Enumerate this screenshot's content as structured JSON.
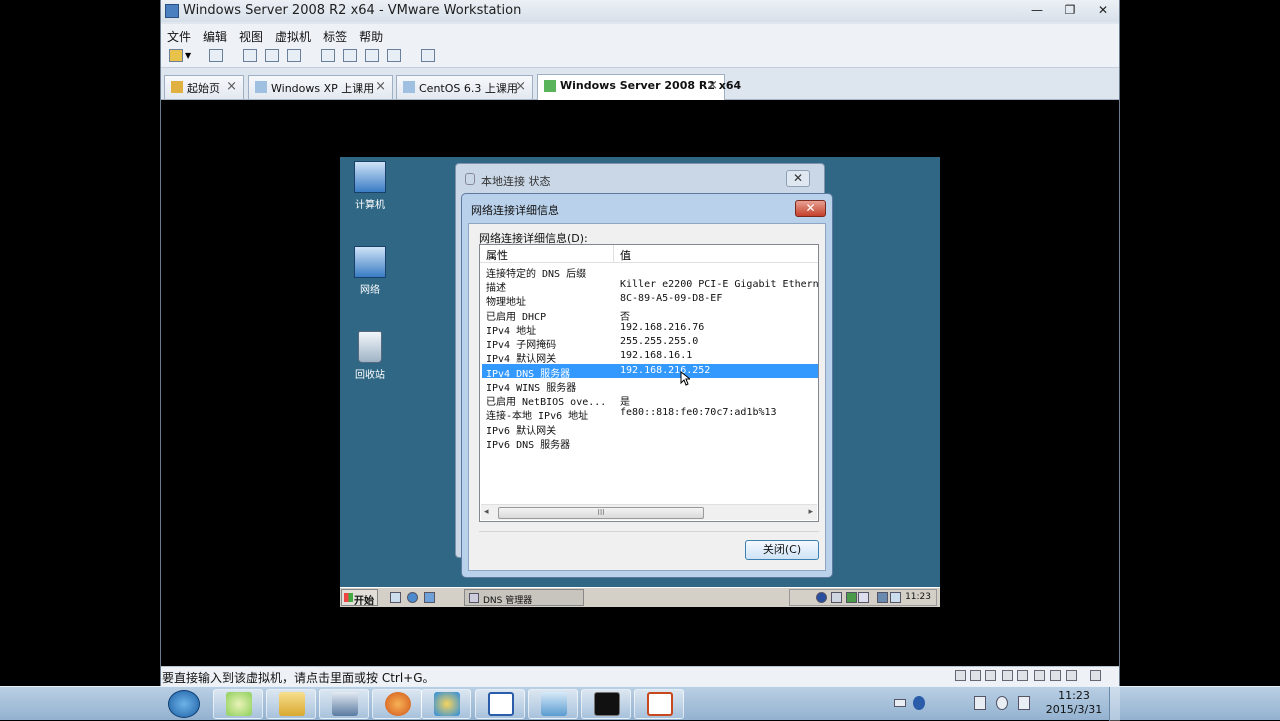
{
  "host_window": {
    "title": "Windows Server 2008 R2 x64 - VMware Workstation",
    "minimize": "—",
    "restore": "❐",
    "close": "✕",
    "menu": [
      "文件",
      "编辑",
      "视图",
      "虚拟机",
      "标签",
      "帮助"
    ],
    "tabs": [
      {
        "label": "起始页",
        "close": "×"
      },
      {
        "label": "Windows XP 上课用",
        "close": "×"
      },
      {
        "label": "CentOS 6.3 上课用",
        "close": "×"
      },
      {
        "label": "Windows Server 2008 R2 x64",
        "close": "×"
      }
    ],
    "status_text": "要直接输入到该虚拟机，请点击里面或按 Ctrl+G。"
  },
  "guest": {
    "desktop_icons": [
      "计算机",
      "网络",
      "回收站"
    ],
    "back_dialog": {
      "title": "本地连接 状态",
      "close": "✕"
    },
    "dialog": {
      "title": "网络连接详细信息",
      "close": "✕",
      "list_label": "网络连接详细信息(D):",
      "col_property": "属性",
      "col_value": "值",
      "rows": [
        {
          "k": "连接特定的 DNS 后缀",
          "v": ""
        },
        {
          "k": "描述",
          "v": "Killer e2200 PCI-E Gigabit Ethern"
        },
        {
          "k": "物理地址",
          "v": "8C-89-A5-09-D8-EF"
        },
        {
          "k": "已启用 DHCP",
          "v": "否"
        },
        {
          "k": "IPv4 地址",
          "v": "192.168.216.76"
        },
        {
          "k": "IPv4 子网掩码",
          "v": "255.255.255.0"
        },
        {
          "k": "IPv4 默认网关",
          "v": "192.168.16.1"
        },
        {
          "k": "IPv4 DNS 服务器",
          "v": "192.168.216.252"
        },
        {
          "k": "IPv4 WINS 服务器",
          "v": ""
        },
        {
          "k": "已启用 NetBIOS ove...",
          "v": "是"
        },
        {
          "k": "连接-本地 IPv6 地址",
          "v": "fe80::818:fe0:70c7:ad1b%13"
        },
        {
          "k": "IPv6 默认网关",
          "v": ""
        },
        {
          "k": "IPv6 DNS 服务器",
          "v": ""
        }
      ],
      "selected_row": 7,
      "scroll_left": "◂",
      "scroll_right": "▸",
      "scroll_grip": "III",
      "close_button": "关闭(C)"
    },
    "taskbar": {
      "start": "开始",
      "task": "DNS 管理器",
      "clock": "11:23"
    }
  },
  "host_taskbar": {
    "time": "11:23",
    "date": "2015/3/31"
  }
}
